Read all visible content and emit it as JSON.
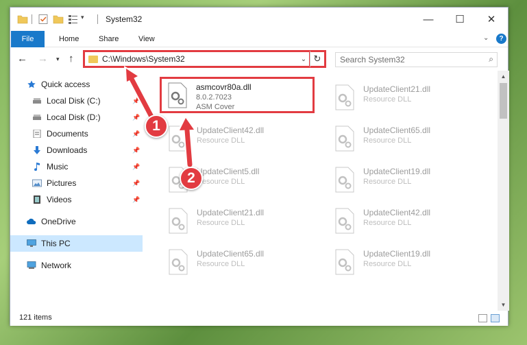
{
  "window": {
    "title": "System32"
  },
  "controls": {
    "minimize": "—",
    "maximize": "☐",
    "close": "✕"
  },
  "ribbon": {
    "tabs": [
      "File",
      "Home",
      "Share",
      "View"
    ],
    "help": "?"
  },
  "address": {
    "path": "C:\\Windows\\System32",
    "refresh_icon": "↻"
  },
  "search": {
    "placeholder": "Search System32"
  },
  "sidebar": {
    "items": [
      {
        "label": "Quick access",
        "icon": "star-icon",
        "pinned": false
      },
      {
        "label": "Local Disk (C:)",
        "icon": "drive-icon",
        "pinned": true
      },
      {
        "label": "Local Disk (D:)",
        "icon": "drive-icon",
        "pinned": true
      },
      {
        "label": "Documents",
        "icon": "documents-icon",
        "pinned": true
      },
      {
        "label": "Downloads",
        "icon": "download-icon",
        "pinned": true
      },
      {
        "label": "Music",
        "icon": "music-icon",
        "pinned": true
      },
      {
        "label": "Pictures",
        "icon": "pictures-icon",
        "pinned": true
      },
      {
        "label": "Videos",
        "icon": "videos-icon",
        "pinned": true
      },
      {
        "label": "OneDrive",
        "icon": "cloud-icon",
        "pinned": false
      },
      {
        "label": "This PC",
        "icon": "computer-icon",
        "pinned": false,
        "selected": true
      },
      {
        "label": "Network",
        "icon": "network-icon",
        "pinned": false
      }
    ]
  },
  "files": [
    {
      "name": "asmcovr80a.dll",
      "line1": "8.0.2.7023",
      "line2": "ASM Cover",
      "highlighted": true
    },
    {
      "name": "UpdateClient21.dll",
      "line1": "Resource DLL"
    },
    {
      "name": "UpdateClient42.dll",
      "line1": "Resource DLL"
    },
    {
      "name": "UpdateClient65.dll",
      "line1": "Resource DLL"
    },
    {
      "name": "UpdateClient5.dll",
      "line1": "Resource DLL"
    },
    {
      "name": "UpdateClient19.dll",
      "line1": "Resource DLL"
    },
    {
      "name": "UpdateClient21.dll",
      "line1": "Resource DLL"
    },
    {
      "name": "UpdateClient42.dll",
      "line1": "Resource DLL"
    },
    {
      "name": "UpdateClient65.dll",
      "line1": "Resource DLL"
    },
    {
      "name": "UpdateClient19.dll",
      "line1": "Resource DLL"
    }
  ],
  "status": {
    "item_count": "121 items"
  },
  "markers": [
    "1",
    "2"
  ],
  "colors": {
    "accent": "#1979ca",
    "highlight_red": "#e23b41",
    "selected_bg": "#cce8ff"
  }
}
